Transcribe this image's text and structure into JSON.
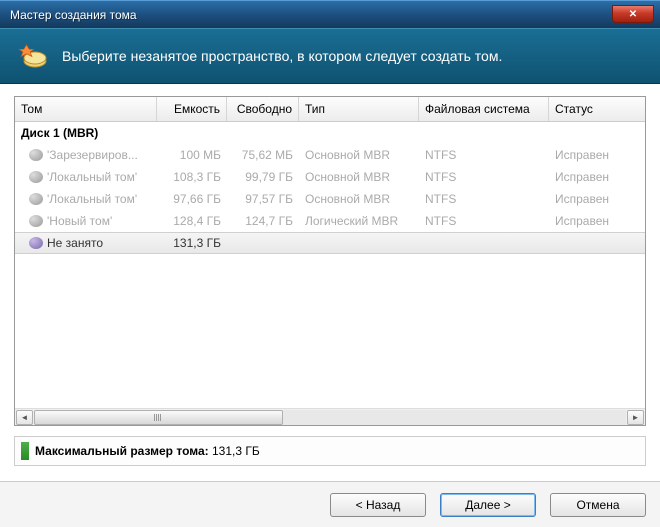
{
  "window": {
    "title": "Мастер создания тома",
    "close_icon": "✕"
  },
  "banner": {
    "text": "Выберите незанятое пространство, в котором следует создать том."
  },
  "columns": {
    "name": "Том",
    "capacity": "Емкость",
    "free": "Свободно",
    "type": "Тип",
    "fs": "Файловая система",
    "status": "Статус"
  },
  "group": {
    "label": "Диск 1 (MBR)"
  },
  "rows": [
    {
      "name": "'Зарезервиров...",
      "cap": "100 МБ",
      "free": "75,62 МБ",
      "type": "Основной MBR",
      "fs": "NTFS",
      "status": "Исправен",
      "selected": false
    },
    {
      "name": "'Локальный том'",
      "cap": "108,3 ГБ",
      "free": "99,79 ГБ",
      "type": "Основной MBR",
      "fs": "NTFS",
      "status": "Исправен",
      "selected": false
    },
    {
      "name": "'Локальный том'",
      "cap": "97,66 ГБ",
      "free": "97,57 ГБ",
      "type": "Основной MBR",
      "fs": "NTFS",
      "status": "Исправен",
      "selected": false
    },
    {
      "name": "'Новый том'",
      "cap": "128,4 ГБ",
      "free": "124,7 ГБ",
      "type": "Логический MBR",
      "fs": "NTFS",
      "status": "Исправен",
      "selected": false
    },
    {
      "name": "Не занято",
      "cap": "131,3 ГБ",
      "free": "",
      "type": "",
      "fs": "",
      "status": "",
      "selected": true
    }
  ],
  "maxsize": {
    "label": "Максимальный размер тома:",
    "value": "131,3 ГБ"
  },
  "buttons": {
    "back": "< Назад",
    "next": "Далее >",
    "cancel": "Отмена"
  }
}
